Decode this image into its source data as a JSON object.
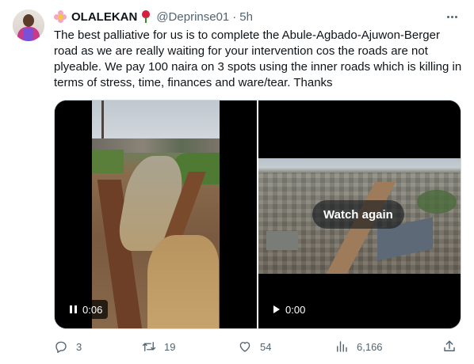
{
  "author": {
    "display_name": "OLALEKAN",
    "handle": "@Deprinse01",
    "separator": "·",
    "time": "5h"
  },
  "tweet": {
    "text": "The best palliative for us is to complete the Abule-Agbado-Ajuwon-Berger road as we are really waiting for your intervention cos the roads are not plyeable. We pay 100 naira on 3 spots using the inner roads which is killing in terms of stress, time, finances and ware/tear. Thanks"
  },
  "media": {
    "video1": {
      "timestamp": "0:06",
      "state": "playing"
    },
    "video2": {
      "timestamp": "0:00",
      "state": "paused",
      "overlay_label": "Watch again"
    }
  },
  "actions": {
    "replies": "3",
    "retweets": "19",
    "likes": "54",
    "views": "6,166"
  },
  "icons": {
    "more": "more-horizontal-icon",
    "reply": "reply-icon",
    "retweet": "retweet-icon",
    "like": "heart-icon",
    "views": "views-chart-icon",
    "share": "share-icon"
  },
  "colors": {
    "text": "#0f1419",
    "secondary": "#536471",
    "border": "#cfd9de"
  }
}
